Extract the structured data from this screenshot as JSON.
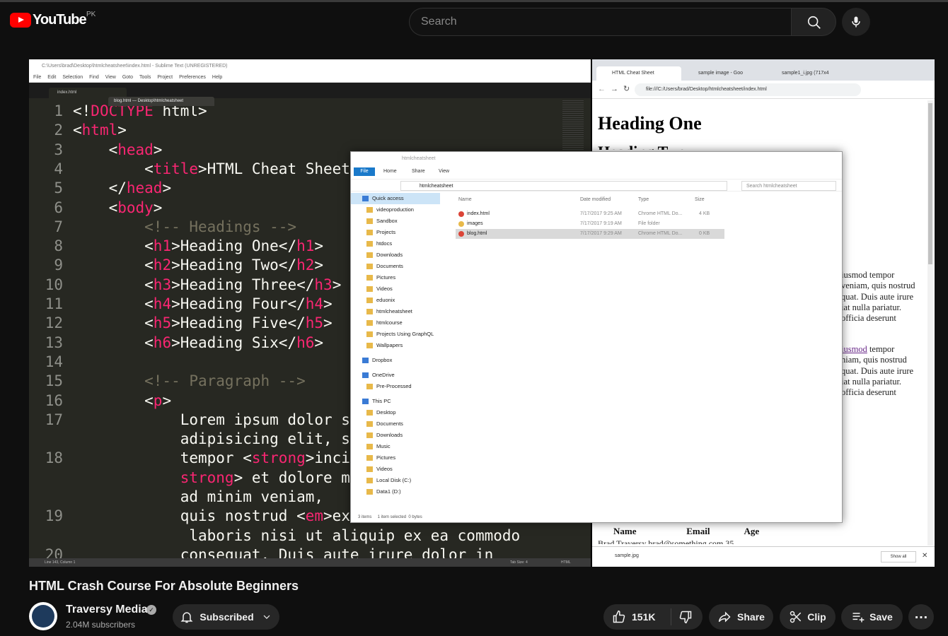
{
  "header": {
    "logo_text": "YouTube",
    "country": "PK",
    "search_placeholder": "Search"
  },
  "video": {
    "sublime": {
      "title": "C:\\Users\\brad\\Desktop\\htmlcheatsheet\\index.html - Sublime Text (UNREGISTERED)",
      "menu": [
        "File",
        "Edit",
        "Selection",
        "Find",
        "View",
        "Goto",
        "Tools",
        "Project",
        "Preferences",
        "Help"
      ],
      "tab_active": "index.html",
      "tab_drag": "blog.html — Desktop\\htmlcheatsheet",
      "status_left": "Line 143, Column 1",
      "status_tab": "Tab Size: 4",
      "status_syntax": "HTML",
      "lines": [
        {
          "n": "1",
          "parts": [
            [
              "",
              "<!"
            ],
            [
              "t",
              "DOCTYPE"
            ],
            [
              "",
              " html>"
            ]
          ]
        },
        {
          "n": "2",
          "parts": [
            [
              "",
              "<"
            ],
            [
              "t",
              "html"
            ],
            [
              "",
              ">"
            ]
          ]
        },
        {
          "n": "3",
          "parts": [
            [
              "",
              "    <"
            ],
            [
              "t",
              "head"
            ],
            [
              "",
              ">"
            ]
          ]
        },
        {
          "n": "4",
          "parts": [
            [
              "",
              "        <"
            ],
            [
              "t",
              "title"
            ],
            [
              "",
              ">HTML Cheat Sheet"
            ]
          ]
        },
        {
          "n": "5",
          "parts": [
            [
              "",
              "    </"
            ],
            [
              "t",
              "head"
            ],
            [
              "",
              ">"
            ]
          ]
        },
        {
          "n": "6",
          "parts": [
            [
              "",
              "    <"
            ],
            [
              "t",
              "body"
            ],
            [
              "",
              ">"
            ]
          ]
        },
        {
          "n": "7",
          "parts": [
            [
              "cmt",
              "        <!-- Headings -->"
            ]
          ]
        },
        {
          "n": "8",
          "parts": [
            [
              "",
              "        <"
            ],
            [
              "t",
              "h1"
            ],
            [
              "",
              ">Heading One</"
            ],
            [
              "t",
              "h1"
            ],
            [
              "",
              ">"
            ]
          ]
        },
        {
          "n": "9",
          "parts": [
            [
              "",
              "        <"
            ],
            [
              "t",
              "h2"
            ],
            [
              "",
              ">Heading Two</"
            ],
            [
              "t",
              "h2"
            ],
            [
              "",
              ">"
            ]
          ]
        },
        {
          "n": "10",
          "parts": [
            [
              "",
              "        <"
            ],
            [
              "t",
              "h3"
            ],
            [
              "",
              ">Heading Three</"
            ],
            [
              "t",
              "h3"
            ],
            [
              "",
              ">"
            ]
          ]
        },
        {
          "n": "11",
          "parts": [
            [
              "",
              "        <"
            ],
            [
              "t",
              "h4"
            ],
            [
              "",
              ">Heading Four</"
            ],
            [
              "t",
              "h4"
            ],
            [
              "",
              ">"
            ]
          ]
        },
        {
          "n": "12",
          "parts": [
            [
              "",
              "        <"
            ],
            [
              "t",
              "h5"
            ],
            [
              "",
              ">Heading Five</"
            ],
            [
              "t",
              "h5"
            ],
            [
              "",
              ">"
            ]
          ]
        },
        {
          "n": "13",
          "parts": [
            [
              "",
              "        <"
            ],
            [
              "t",
              "h6"
            ],
            [
              "",
              ">Heading Six</"
            ],
            [
              "t",
              "h6"
            ],
            [
              "",
              ">"
            ]
          ]
        },
        {
          "n": "14",
          "parts": [
            [
              "",
              ""
            ]
          ]
        },
        {
          "n": "15",
          "parts": [
            [
              "cmt",
              "        <!-- Paragraph -->"
            ]
          ]
        },
        {
          "n": "16",
          "parts": [
            [
              "",
              "        <"
            ],
            [
              "t",
              "p"
            ],
            [
              "",
              ">"
            ]
          ]
        },
        {
          "n": "17",
          "parts": [
            [
              "",
              "            Lorem ipsum dolor s"
            ]
          ]
        },
        {
          "n": "",
          "parts": [
            [
              "",
              "            adipisicing elit, s"
            ]
          ]
        },
        {
          "n": "18",
          "parts": [
            [
              "",
              "            tempor <"
            ],
            [
              "t",
              "strong"
            ],
            [
              "",
              ">inci"
            ]
          ]
        },
        {
          "n": "",
          "parts": [
            [
              "t",
              "            strong"
            ],
            [
              "",
              "> et dolore m"
            ]
          ]
        },
        {
          "n": "",
          "parts": [
            [
              "",
              "            ad minim veniam,"
            ]
          ]
        },
        {
          "n": "19",
          "parts": [
            [
              "",
              "            quis nostrud <"
            ],
            [
              "t",
              "em"
            ],
            [
              "",
              ">ex"
            ]
          ]
        },
        {
          "n": "",
          "parts": [
            [
              "",
              "             laboris nisi ut aliquip ex ea commodo"
            ]
          ]
        },
        {
          "n": "20",
          "parts": [
            [
              "",
              "            consequat. Duis aute irure dolor in"
            ]
          ]
        }
      ]
    },
    "chrome": {
      "tabs": [
        "HTML Cheat Sheet",
        "sample image - Goo",
        "sample1_i.jpg (717x4"
      ],
      "url": "file:///C:/Users/brad/Desktop/htmlcheatsheet/index.html",
      "heading_one": "Heading One",
      "heading_two": "Heading Two",
      "para1": "iusmod tempor\nveniam, quis nostrud\nquat. Duis aute irure\niat nulla pariatur.\nofficia deserunt",
      "para2_link": "iusmod",
      "para2_rest": " tempor\nniam, quis nostrud\nquat. Duis aute irure\niat nulla pariatur.\nofficia deserunt",
      "table_headers": [
        "Name",
        "Email",
        "Age"
      ],
      "table_row": "Brad Traversy  brad@something.com  35",
      "download_file": "sample.jpg",
      "show_all": "Show all"
    },
    "explorer": {
      "title": "htmlcheatsheet",
      "ribbon": [
        "File",
        "Home",
        "Share",
        "View"
      ],
      "path": "htmlcheatsheet",
      "search_placeholder": "Search htmlcheatsheet",
      "columns": [
        "Name",
        "Date modified",
        "Type",
        "Size"
      ],
      "files": [
        {
          "name": "index.html",
          "date": "7/17/2017 9:25 AM",
          "type": "Chrome HTML Do...",
          "size": "4 KB"
        },
        {
          "name": "images",
          "date": "7/17/2017 9:19 AM",
          "type": "File folder",
          "size": ""
        },
        {
          "name": "blog.html",
          "date": "7/17/2017 9:29 AM",
          "type": "Chrome HTML Do...",
          "size": "0 KB"
        }
      ],
      "nav": [
        "Quick access",
        "videoproduction",
        "Sandbox",
        "Projects",
        "htdocs",
        "Downloads",
        "Documents",
        "Pictures",
        "Videos",
        "eduonix",
        "htmlcheatsheet",
        "htmlcourse",
        "Projects Using GraphQL",
        "Wallpapers",
        "Dropbox",
        "OneDrive",
        "Pre-Processed",
        "This PC",
        "Desktop",
        "Documents",
        "Downloads",
        "Music",
        "Pictures",
        "Videos",
        "Local Disk (C:)",
        "Data1 (D:)"
      ],
      "status": "3 items     1 item selected  0 bytes"
    }
  },
  "below": {
    "title": "HTML Crash Course For Absolute Beginners",
    "channel": "Traversy Media",
    "subscribers": "2.04M subscribers",
    "subscribed_label": "Subscribed",
    "likes": "151K",
    "share_label": "Share",
    "clip_label": "Clip",
    "save_label": "Save"
  }
}
